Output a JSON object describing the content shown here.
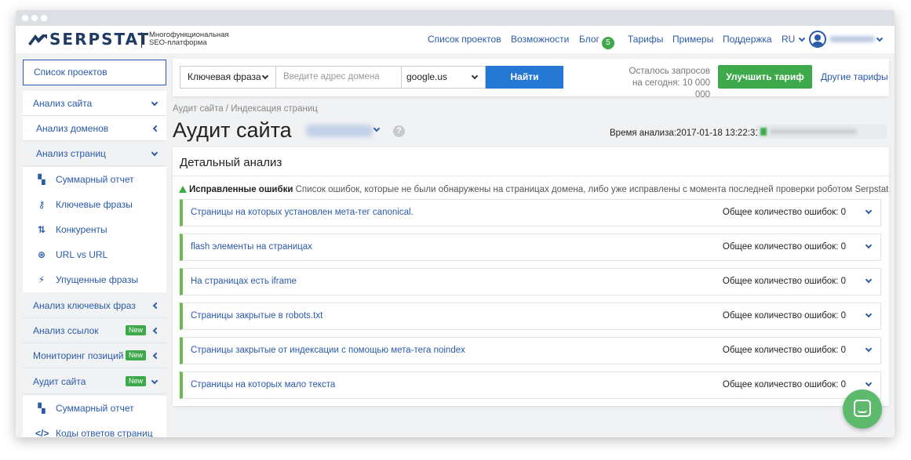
{
  "header": {
    "logo_text": "SERPSTAT",
    "logo_sub_1": "Многофункциональная",
    "logo_sub_2": "SEO-платформа",
    "nav": [
      "Список проектов",
      "Возможности",
      "Блог",
      "Тарифы",
      "Примеры",
      "Поддержка"
    ],
    "blog_badge": "5",
    "language": "RU"
  },
  "sidebar": {
    "projects_button": "Список проектов",
    "site_analysis": "Анализ сайта",
    "domain_analysis": "Анализ доменов",
    "page_analysis": "Анализ страниц",
    "page_children": [
      "Суммарный отчет",
      "Ключевые фразы",
      "Конкуренты",
      "URL vs URL",
      "Упущенные фразы"
    ],
    "keyword_analysis": "Анализ ключевых фраз",
    "link_analysis": "Анализ ссылок",
    "position_monitoring": "Мониторинг позиций",
    "site_audit": "Аудит сайта",
    "new_badge": "New",
    "audit_children": [
      "Суммарный отчет",
      "Коды ответов страниц"
    ]
  },
  "search": {
    "phrase_select": "Ключевая фраза",
    "domain_placeholder": "Введите адрес домена",
    "engine_select": "google.us",
    "find_button": "Найти",
    "requests_left_1": "Осталось запросов",
    "requests_left_2": "на сегодня: 10 000 000",
    "upgrade_button": "Улучшить тариф",
    "other_tariffs": "Другие тарифы"
  },
  "main": {
    "breadcrumb": "Аудит сайта / Индексация страниц",
    "title": "Аудит сайта",
    "help": "?",
    "analysis_time": "Время анализа:2017-01-18 13:22:31",
    "panel_title": "Детальный анализ",
    "notice_bold": "Исправленные ошибки",
    "notice_text": " Список ошибок, которые не были обнаружены на страницах домена, либо уже исправлены с момента последней проверки роботом Serpstat",
    "errors": [
      {
        "name": "Страницы на которых установлен мета-тег canonical.",
        "count": "Общее количество ошибок: 0"
      },
      {
        "name": "flash элементы на страницах",
        "count": "Общее количество ошибок: 0"
      },
      {
        "name": "На страницах есть iframe",
        "count": "Общее количество ошибок: 0"
      },
      {
        "name": "Страницы закрытые в robots.txt",
        "count": "Общее количество ошибок: 0"
      },
      {
        "name": "Страницы закрытые от индексации с помощью мета-тега noindex",
        "count": "Общее количество ошибок: 0"
      },
      {
        "name": "Страницы на которых мало текста",
        "count": "Общее количество ошибок: 0"
      }
    ]
  },
  "colors": {
    "accent_blue": "#2a5aa8",
    "button_blue": "#2577d4",
    "green": "#3ea94b",
    "logo_navy": "#1f3a63"
  }
}
